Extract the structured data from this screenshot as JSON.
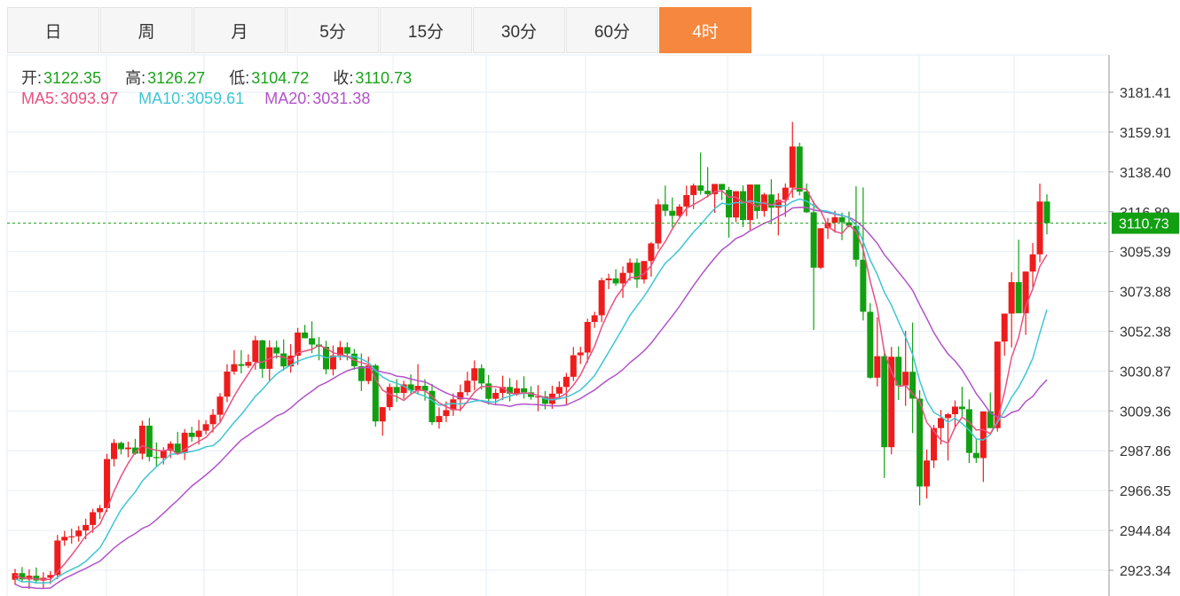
{
  "tabs": [
    {
      "label": "日",
      "active": false
    },
    {
      "label": "周",
      "active": false
    },
    {
      "label": "月",
      "active": false
    },
    {
      "label": "5分",
      "active": false
    },
    {
      "label": "15分",
      "active": false
    },
    {
      "label": "30分",
      "active": false
    },
    {
      "label": "60分",
      "active": false
    },
    {
      "label": "4时",
      "active": true
    }
  ],
  "ohlc_info": {
    "open_label": "开:",
    "open": "3122.35",
    "high_label": "高:",
    "high": "3126.27",
    "low_label": "低:",
    "low": "3104.72",
    "close_label": "收:",
    "close": "3110.73"
  },
  "ma_info": {
    "ma5_label": "MA5:",
    "ma5": "3093.97",
    "ma10_label": "MA10:",
    "ma10": "3059.61",
    "ma20_label": "MA20:",
    "ma20": "3031.38"
  },
  "colors": {
    "up": "#ee1c1c",
    "down": "#12a012",
    "ma5": "#e8517f",
    "ma10": "#3ec6d3",
    "ma20": "#b253c9",
    "active_tab": "#f5883e",
    "grid": "#e6eef5",
    "last_price": "#12a012"
  },
  "chart_data": {
    "type": "candlestick",
    "y_ticks": [
      "3181.41",
      "3159.91",
      "3138.40",
      "3116.89",
      "3095.39",
      "3073.88",
      "3052.38",
      "3030.87",
      "3009.36",
      "2987.86",
      "2966.35",
      "2944.84",
      "2923.34"
    ],
    "ylim": [
      2918,
      3190
    ],
    "last_price": "3110.73",
    "candles": [
      [
        2918.2,
        2924.1,
        2915.5,
        2921.8
      ],
      [
        2921.8,
        2925.1,
        2916.9,
        2918.4
      ],
      [
        2918.4,
        2923.8,
        2913.2,
        2920.4
      ],
      [
        2920.4,
        2924.8,
        2916.1,
        2917.8
      ],
      [
        2917.8,
        2922.3,
        2913.7,
        2919.3
      ],
      [
        2919.3,
        2922.9,
        2915.9,
        2920.8
      ],
      [
        2920.8,
        2942.4,
        2918.6,
        2939.4
      ],
      [
        2939.4,
        2944.6,
        2936.5,
        2941.4
      ],
      [
        2941.4,
        2945.8,
        2937.7,
        2941.7
      ],
      [
        2941.7,
        2947.2,
        2938.8,
        2944.8
      ],
      [
        2944.8,
        2951.2,
        2940.1,
        2947.8
      ],
      [
        2947.8,
        2956.5,
        2943.6,
        2954.7
      ],
      [
        2954.7,
        2958.6,
        2951.0,
        2956.9
      ],
      [
        2956.9,
        2986.2,
        2954.8,
        2983.4
      ],
      [
        2983.4,
        2994.1,
        2979.4,
        2992.1
      ],
      [
        2992.1,
        2992.8,
        2985.9,
        2988.7
      ],
      [
        2988.7,
        2992.8,
        2984.3,
        2989.6
      ],
      [
        2989.6,
        2994.3,
        2985.7,
        2986.3
      ],
      [
        2986.3,
        3004.1,
        2983.2,
        3001.4
      ],
      [
        3001.4,
        3005.6,
        2982.1,
        2984.5
      ],
      [
        2984.5,
        2992.4,
        2978.9,
        2983.9
      ],
      [
        2983.9,
        2989.8,
        2980.5,
        2987.9
      ],
      [
        2987.9,
        2993.0,
        2983.9,
        2991.7
      ],
      [
        2991.7,
        2998.1,
        2986.2,
        2986.6
      ],
      [
        2986.6,
        2999.6,
        2982.9,
        2997.6
      ],
      [
        2997.6,
        3000.8,
        2992.7,
        2995.3
      ],
      [
        2995.3,
        3004.5,
        2991.2,
        2998.7
      ],
      [
        2998.7,
        3004.4,
        2996.7,
        3002.2
      ],
      [
        3002.2,
        3010.4,
        2997.7,
        3007.3
      ],
      [
        3007.3,
        3019.0,
        3003.3,
        3017.1
      ],
      [
        3017.1,
        3034.6,
        3014.1,
        3030.6
      ],
      [
        3030.6,
        3042.2,
        3029.0,
        3034.6
      ],
      [
        3034.6,
        3042.2,
        3029.6,
        3033.7
      ],
      [
        3033.7,
        3039.9,
        3032.6,
        3035.8
      ],
      [
        3035.8,
        3049.9,
        3031.6,
        3047.5
      ],
      [
        3047.5,
        3047.7,
        3027.2,
        3032.1
      ],
      [
        3032.1,
        3047.5,
        3025.6,
        3043.7
      ],
      [
        3043.7,
        3047.3,
        3037.6,
        3040.4
      ],
      [
        3040.4,
        3048.0,
        3031.2,
        3033.4
      ],
      [
        3033.4,
        3045.4,
        3030.0,
        3039.2
      ],
      [
        3039.2,
        3054.2,
        3034.2,
        3051.7
      ],
      [
        3051.7,
        3055.8,
        3049.4,
        3048.6
      ],
      [
        3048.6,
        3057.8,
        3040.5,
        3045.2
      ],
      [
        3045.2,
        3049.3,
        3036.7,
        3044.0
      ],
      [
        3044.0,
        3047.2,
        3029.1,
        3031.8
      ],
      [
        3031.8,
        3044.7,
        3028.5,
        3039.3
      ],
      [
        3039.3,
        3047.1,
        3036.7,
        3043.8
      ],
      [
        3043.8,
        3046.4,
        3036.6,
        3040.3
      ],
      [
        3040.3,
        3042.8,
        3031.5,
        3033.5
      ],
      [
        3033.5,
        3040.4,
        3020.1,
        3025.5
      ],
      [
        3025.5,
        3038.6,
        3023.8,
        3033.9
      ],
      [
        3033.9,
        3034.8,
        3000.9,
        3003.7
      ],
      [
        3003.7,
        3010.4,
        2996.0,
        3011.4
      ],
      [
        3011.4,
        3024.2,
        3009.6,
        3022.3
      ],
      [
        3022.3,
        3026.6,
        3014.3,
        3019.1
      ],
      [
        3019.1,
        3025.6,
        3015.8,
        3023.7
      ],
      [
        3023.7,
        3029.1,
        3018.6,
        3020.4
      ],
      [
        3020.4,
        3034.6,
        3018.7,
        3022.9
      ],
      [
        3022.9,
        3026.5,
        3014.9,
        3020.2
      ],
      [
        3020.2,
        3023.9,
        3001.8,
        3003.3
      ],
      [
        3003.3,
        3011.3,
        2999.8,
        3006.6
      ],
      [
        3006.6,
        3014.5,
        3003.3,
        3009.8
      ],
      [
        3009.8,
        3018.8,
        3006.7,
        3015.6
      ],
      [
        3015.6,
        3023.6,
        3009.2,
        3019.5
      ],
      [
        3019.5,
        3030.5,
        3017.6,
        3025.7
      ],
      [
        3025.7,
        3036.6,
        3020.5,
        3032.4
      ],
      [
        3032.4,
        3034.5,
        3020.9,
        3024.2
      ],
      [
        3024.2,
        3028.8,
        3012.8,
        3015.9
      ],
      [
        3015.9,
        3021.3,
        3013.1,
        3019.1
      ],
      [
        3019.1,
        3028.4,
        3015.3,
        3022.3
      ],
      [
        3022.3,
        3027.1,
        3014.5,
        3018.7
      ],
      [
        3018.7,
        3026.0,
        3017.6,
        3021.6
      ],
      [
        3021.6,
        3028.1,
        3016.0,
        3019.4
      ],
      [
        3019.4,
        3022.7,
        3015.4,
        3016.9
      ],
      [
        3016.9,
        3023.3,
        3009.2,
        3017.2
      ],
      [
        3017.2,
        3020.1,
        3010.2,
        3013.2
      ],
      [
        3013.2,
        3023.0,
        3010.5,
        3018.7
      ],
      [
        3018.7,
        3025.3,
        3015.9,
        3022.3
      ],
      [
        3022.3,
        3029.9,
        3012.9,
        3027.8
      ],
      [
        3027.8,
        3043.9,
        3025.5,
        3039.4
      ],
      [
        3039.4,
        3044.0,
        3034.7,
        3040.9
      ],
      [
        3040.9,
        3059.2,
        3035.5,
        3057.4
      ],
      [
        3057.4,
        3062.9,
        3054.2,
        3061.0
      ],
      [
        3061.0,
        3081.2,
        3057.3,
        3079.9
      ],
      [
        3079.9,
        3083.4,
        3075.1,
        3080.9
      ],
      [
        3080.9,
        3085.9,
        3076.9,
        3078.2
      ],
      [
        3078.2,
        3087.4,
        3070.4,
        3083.9
      ],
      [
        3083.9,
        3091.7,
        3079.7,
        3089.4
      ],
      [
        3089.4,
        3091.7,
        3075.8,
        3080.3
      ],
      [
        3080.3,
        3089.6,
        3078.1,
        3090.3
      ],
      [
        3090.3,
        3100.5,
        3081.8,
        3099.8
      ],
      [
        3099.8,
        3123.8,
        3096.8,
        3120.9
      ],
      [
        3120.9,
        3131.0,
        3114.5,
        3117.4
      ],
      [
        3117.4,
        3124.6,
        3108.4,
        3114.7
      ],
      [
        3114.7,
        3121.0,
        3114.0,
        3119.7
      ],
      [
        3119.7,
        3131.0,
        3114.5,
        3125.9
      ],
      [
        3125.9,
        3132.1,
        3118.3,
        3131.1
      ],
      [
        3131.1,
        3148.9,
        3126.1,
        3128.2
      ],
      [
        3128.2,
        3141.0,
        3124.6,
        3126.4
      ],
      [
        3126.4,
        3131.0,
        3116.3,
        3131.9
      ],
      [
        3131.9,
        3128.1,
        3123.2,
        3128.7
      ],
      [
        3128.7,
        3130.3,
        3103.0,
        3113.8
      ],
      [
        3113.8,
        3125.9,
        3111.3,
        3128.0
      ],
      [
        3128.0,
        3131.1,
        3108.6,
        3112.4
      ],
      [
        3112.4,
        3128.2,
        3107.1,
        3131.6
      ],
      [
        3131.6,
        3120.5,
        3113.1,
        3117.3
      ],
      [
        3117.3,
        3127.1,
        3114.2,
        3126.2
      ],
      [
        3126.2,
        3134.4,
        3110.2,
        3119.1
      ],
      [
        3119.1,
        3126.9,
        3104.1,
        3123.3
      ],
      [
        3123.3,
        3132.2,
        3114.1,
        3129.9
      ],
      [
        3129.9,
        3165.4,
        3124.4,
        3152.1
      ],
      [
        3152.1,
        3154.2,
        3125.7,
        3127.8
      ],
      [
        3127.8,
        3132.2,
        3116.2,
        3116.6
      ],
      [
        3116.6,
        3122.8,
        3053.1,
        3086.7
      ],
      [
        3086.7,
        3107.5,
        3086.0,
        3108.0
      ],
      [
        3108.0,
        3113.6,
        3102.3,
        3111.0
      ],
      [
        3111.0,
        3117.4,
        3105.6,
        3113.9
      ],
      [
        3113.9,
        3116.4,
        3101.6,
        3111.2
      ],
      [
        3111.2,
        3117.0,
        3108.4,
        3109.3
      ],
      [
        3109.3,
        3130.7,
        3087.3,
        3091.0
      ],
      [
        3091.0,
        3130.0,
        3058.2,
        3062.9
      ],
      [
        3062.9,
        3067.6,
        3026.7,
        3027.3
      ],
      [
        3027.3,
        3059.9,
        3022.6,
        3038.9
      ],
      [
        3038.9,
        3042.3,
        2973.2,
        2989.8
      ],
      [
        2989.8,
        3043.9,
        2985.9,
        3038.6
      ],
      [
        3038.6,
        3044.2,
        3015.3,
        3023.1
      ],
      [
        3023.1,
        3052.6,
        3012.1,
        3030.5
      ],
      [
        3030.5,
        3057.1,
        2997.4,
        3016.0
      ],
      [
        3016.0,
        3020.6,
        2958.4,
        2968.6
      ],
      [
        2968.6,
        2988.5,
        2962.1,
        2982.6
      ],
      [
        2982.6,
        3001.8,
        2978.5,
        3000.1
      ],
      [
        3000.1,
        3009.9,
        2991.2,
        3005.5
      ],
      [
        3005.5,
        3008.3,
        2982.6,
        3007.6
      ],
      [
        3007.6,
        3015.0,
        2999.8,
        3011.7
      ],
      [
        3011.7,
        3022.4,
        3006.4,
        3010.3
      ],
      [
        3010.3,
        3015.6,
        2981.2,
        2986.7
      ],
      [
        2986.7,
        2994.4,
        2981.3,
        2983.9
      ],
      [
        2983.9,
        3005.9,
        2971.0,
        3009.1
      ],
      [
        3009.1,
        3019.3,
        3001.6,
        3000.1
      ],
      [
        3000.1,
        3033.4,
        2998.2,
        3046.8
      ],
      [
        3046.8,
        3058.2,
        3039.2,
        3061.9
      ],
      [
        3061.9,
        3084.2,
        3043.7,
        3078.9
      ],
      [
        3078.9,
        3101.8,
        3064.4,
        3062.1
      ],
      [
        3062.1,
        3080.3,
        3050.4,
        3084.6
      ],
      [
        3084.6,
        3100.0,
        3076.0,
        3093.9
      ],
      [
        3093.9,
        3132.1,
        3089.6,
        3122.4
      ],
      [
        3122.4,
        3126.3,
        3104.7,
        3110.7
      ]
    ]
  }
}
